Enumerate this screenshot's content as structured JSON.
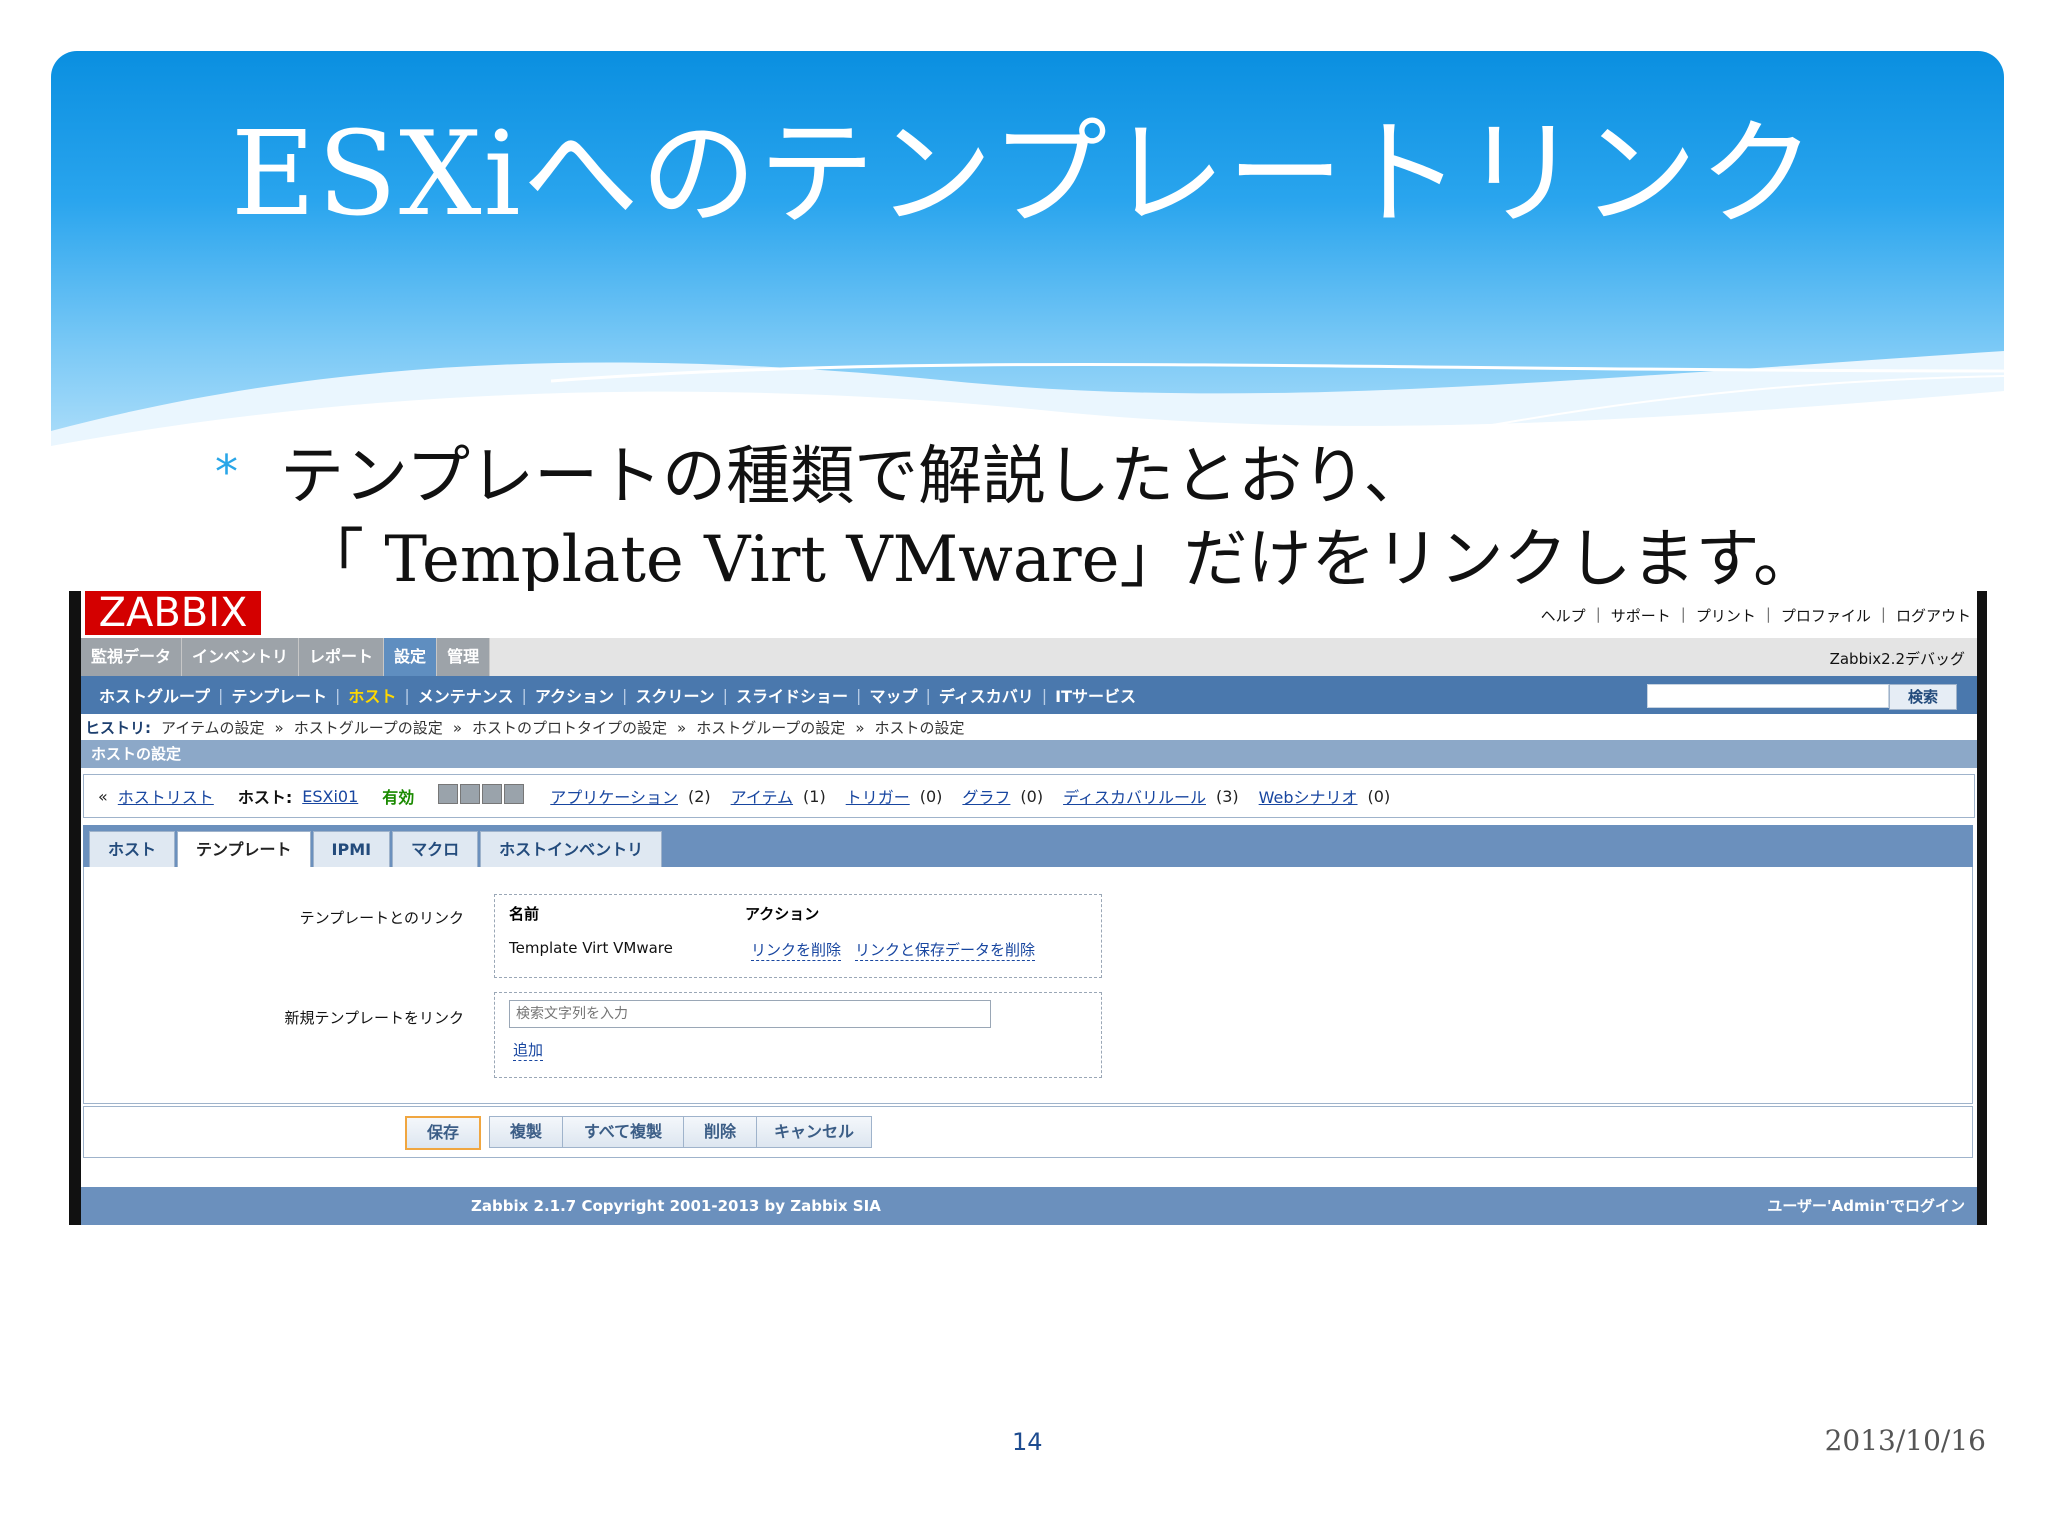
{
  "slide": {
    "title": "ESXiへのテンプレートリンク",
    "bullet_line1": "テンプレートの種類で解説したとおり、",
    "bullet_line2": "「 Template Virt VMware」だけをリンクします。",
    "page_number": "14",
    "date": "2013/10/16"
  },
  "zabbix": {
    "logo": "ZABBIX",
    "top_links": [
      "ヘルプ",
      "サポート",
      "プリント",
      "プロファイル",
      "ログアウト"
    ],
    "version_label": "Zabbix2.2デバッグ",
    "main_menu": [
      "監視データ",
      "インベントリ",
      "レポート",
      "設定",
      "管理"
    ],
    "sub_menu": [
      "ホストグループ",
      "テンプレート",
      "ホスト",
      "メンテナンス",
      "アクション",
      "スクリーン",
      "スライドショー",
      "マップ",
      "ディスカバリ",
      "ITサービス"
    ],
    "search_button": "検索",
    "history_label": "ヒストリ:",
    "history_items": [
      "アイテムの設定",
      "ホストグループの設定",
      "ホストのプロトタイプの設定",
      "ホストグループの設定",
      "ホストの設定"
    ],
    "section_title": "ホストの設定",
    "host_row": {
      "back_marker": "«",
      "host_list": "ホストリスト",
      "host_label": "ホスト:",
      "host_name": "ESXi01",
      "status": "有効",
      "links": [
        {
          "label": "アプリケーション",
          "count": "(2)"
        },
        {
          "label": "アイテム",
          "count": "(1)"
        },
        {
          "label": "トリガー",
          "count": "(0)"
        },
        {
          "label": "グラフ",
          "count": "(0)"
        },
        {
          "label": "ディスカバリルール",
          "count": "(3)"
        },
        {
          "label": "Webシナリオ",
          "count": "(0)"
        }
      ]
    },
    "tabs": [
      "ホスト",
      "テンプレート",
      "IPMI",
      "マクロ",
      "ホストインベントリ"
    ],
    "form": {
      "linked_label": "テンプレートとのリンク",
      "col_name": "名前",
      "col_action": "アクション",
      "template_name": "Template Virt VMware",
      "action_unlink": "リンクを削除",
      "action_unlink_clear": "リンクと保存データを削除",
      "new_label": "新規テンプレートをリンク",
      "search_placeholder": "検索文字列を入力",
      "add_link": "追加"
    },
    "buttons": {
      "save": "保存",
      "clone": "複製",
      "full_clone": "すべて複製",
      "delete": "削除",
      "cancel": "キャンセル"
    },
    "footer_copyright": "Zabbix 2.1.7 Copyright 2001-2013 by Zabbix SIA",
    "footer_user": "ユーザー'Admin'でログイン"
  }
}
